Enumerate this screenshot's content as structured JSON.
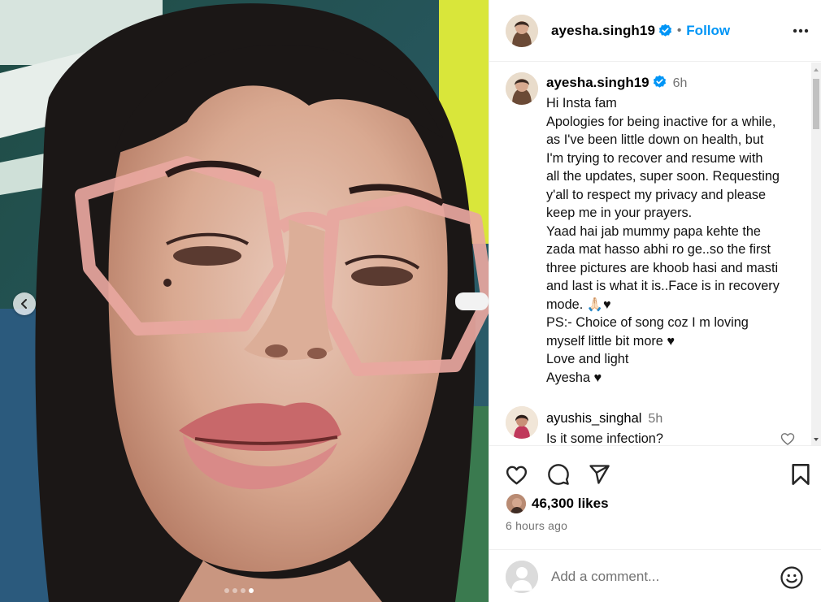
{
  "post": {
    "username": "ayesha.singh19",
    "follow_label": "Follow",
    "separator": "•",
    "more_label": "More options",
    "carousel": {
      "total_slides": 4,
      "active_slide": 4
    }
  },
  "caption": {
    "username": "ayesha.singh19",
    "time": "6h",
    "lines": [
      "Hi Insta fam",
      "Apologies for being inactive for a while,",
      "as I've been little down on health, but",
      "I'm trying to recover and resume with",
      "all the updates, super soon. Requesting",
      "y'all to respect my privacy and please",
      "keep me in your prayers.",
      "Yaad hai jab mummy papa kehte the",
      "zada mat hasso abhi ro ge..so the first",
      "three pictures are khoob hasi and masti",
      "and last is what it is..Face is in recovery",
      "mode. 🙏🏻♥",
      "PS:- Choice of song coz I m loving",
      "myself little bit more ♥",
      "Love and light",
      "Ayesha ♥"
    ]
  },
  "comment": {
    "username": "ayushis_singhal",
    "time": "5h",
    "text": "Is it some infection?"
  },
  "stats": {
    "likes": "46,300 likes",
    "posted": "6 hours ago"
  },
  "add_comment": {
    "placeholder": "Add a comment..."
  },
  "colors": {
    "accent": "#0095f6",
    "muted": "#737373",
    "divider": "#efefef"
  },
  "icons": [
    "chevron-left-icon",
    "verified-badge-icon",
    "more-horizontal-icon",
    "heart-icon",
    "comment-icon",
    "share-icon",
    "bookmark-icon",
    "emoji-icon"
  ]
}
